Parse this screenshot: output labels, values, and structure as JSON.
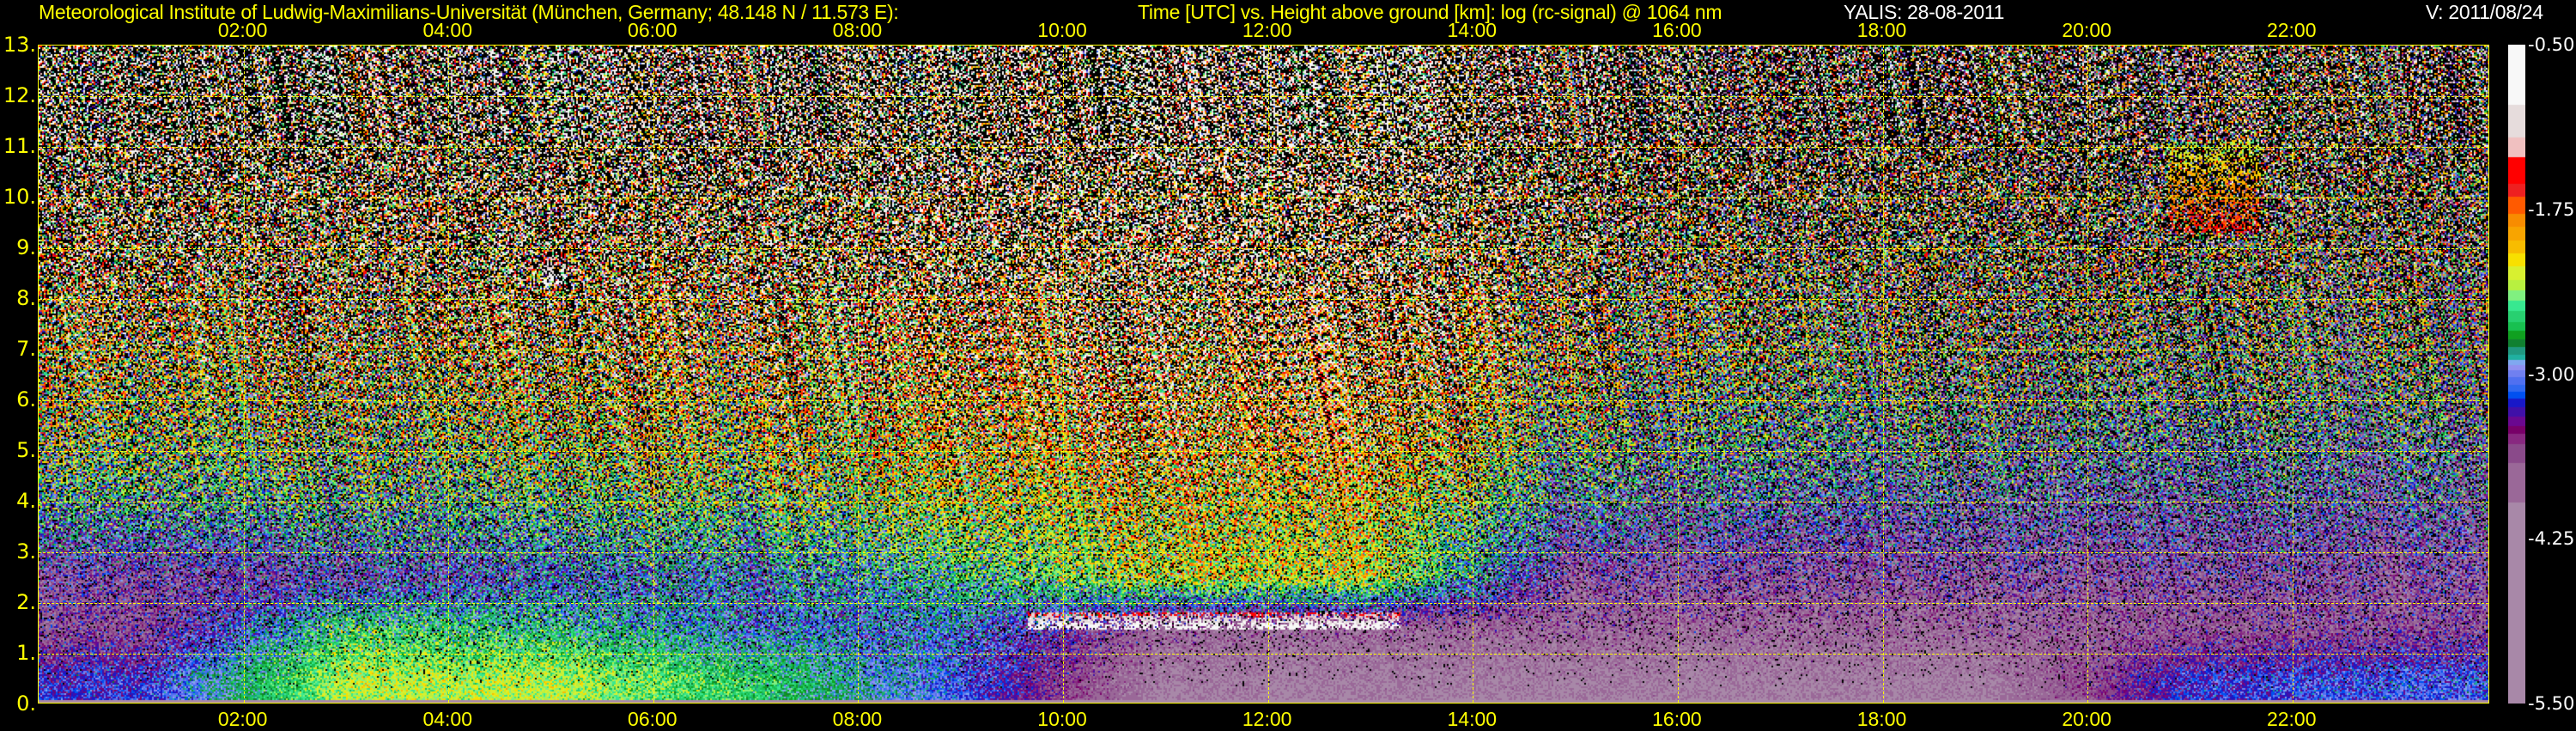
{
  "header": {
    "institute": "Meteorological Institute of Ludwig-Maximilians-Universität (München, Germany; 48.148 N / 11.573 E):",
    "plot_title": "Time [UTC] vs. Height above ground [km]: log (rc-signal) @ 1064 nm",
    "instrument_date": "YALIS: 28-08-2011",
    "version": "V: 2011/08/24"
  },
  "chart_data": {
    "type": "heatmap",
    "title": "Time [UTC] vs. Height above ground [km]: log (rc-signal) @ 1064 nm",
    "xlabel": "Time [UTC]",
    "ylabel": "Height above ground [km]",
    "xlim_hours": [
      0,
      23.93
    ],
    "ylim_km": [
      0,
      13
    ],
    "grid": true,
    "x_ticks": [
      {
        "h": 2,
        "label": "02:00"
      },
      {
        "h": 4,
        "label": "04:00"
      },
      {
        "h": 6,
        "label": "06:00"
      },
      {
        "h": 8,
        "label": "08:00"
      },
      {
        "h": 10,
        "label": "10:00"
      },
      {
        "h": 12,
        "label": "12:00"
      },
      {
        "h": 14,
        "label": "14:00"
      },
      {
        "h": 16,
        "label": "16:00"
      },
      {
        "h": 18,
        "label": "18:00"
      },
      {
        "h": 20,
        "label": "20:00"
      },
      {
        "h": 22,
        "label": "22:00"
      }
    ],
    "y_ticks": [
      {
        "km": 0,
        "label": "0."
      },
      {
        "km": 1,
        "label": "1."
      },
      {
        "km": 2,
        "label": "2."
      },
      {
        "km": 3,
        "label": "3."
      },
      {
        "km": 4,
        "label": "4."
      },
      {
        "km": 5,
        "label": "5."
      },
      {
        "km": 6,
        "label": "6."
      },
      {
        "km": 7,
        "label": "7."
      },
      {
        "km": 8,
        "label": "8."
      },
      {
        "km": 9,
        "label": "9."
      },
      {
        "km": 10,
        "label": "10."
      },
      {
        "km": 11,
        "label": "11."
      },
      {
        "km": 12,
        "label": "12."
      },
      {
        "km": 13,
        "label": "13."
      }
    ],
    "colorbar": {
      "range": [
        -5.5,
        -0.5
      ],
      "ticks": [
        {
          "v": -0.5,
          "label": "-0.50"
        },
        {
          "v": -1.75,
          "label": "-1.75"
        },
        {
          "v": -3.0,
          "label": "-3.00"
        },
        {
          "v": -4.25,
          "label": "-4.25"
        },
        {
          "v": -5.5,
          "label": "-5.50"
        }
      ],
      "levels": [
        [
          -0.95,
          "#f8f8f8"
        ],
        [
          -1.2,
          "#e6dcdc"
        ],
        [
          -1.35,
          "#f0c0c0"
        ],
        [
          -1.55,
          "#ff0000"
        ],
        [
          -1.65,
          "#ee2020"
        ],
        [
          -1.78,
          "#ff5a00"
        ],
        [
          -1.88,
          "#f88c00"
        ],
        [
          -1.98,
          "#f8a400"
        ],
        [
          -2.08,
          "#f8bc00"
        ],
        [
          -2.18,
          "#f8e000"
        ],
        [
          -2.28,
          "#d8f030"
        ],
        [
          -2.36,
          "#b8f040"
        ],
        [
          -2.44,
          "#80f080"
        ],
        [
          -2.52,
          "#38e890"
        ],
        [
          -2.6,
          "#28d070"
        ],
        [
          -2.67,
          "#18c050"
        ],
        [
          -2.73,
          "#10a020"
        ],
        [
          -2.79,
          "#108030"
        ],
        [
          -2.85,
          "#209880"
        ],
        [
          -2.89,
          "#20b0a0"
        ],
        [
          -2.93,
          "#80a8f0"
        ],
        [
          -2.97,
          "#9090f0"
        ],
        [
          -3.02,
          "#7080f0"
        ],
        [
          -3.08,
          "#5070f0"
        ],
        [
          -3.13,
          "#3068f0"
        ],
        [
          -3.18,
          "#0050f0"
        ],
        [
          -3.25,
          "#1818c8"
        ],
        [
          -3.32,
          "#4010a8"
        ],
        [
          -3.39,
          "#6a0890"
        ],
        [
          -3.45,
          "#780068"
        ],
        [
          -3.53,
          "#882880"
        ],
        [
          -3.67,
          "#8a4a8a"
        ],
        [
          -3.97,
          "#9a6898"
        ],
        [
          -5.5,
          "#a888a8"
        ]
      ]
    },
    "grid_times_h": [
      1,
      3,
      5,
      7,
      9,
      11,
      13,
      15,
      17,
      19,
      21,
      23
    ],
    "grid_heights_km": [
      12.5,
      11.5,
      10.5,
      9.5,
      8.5,
      7.5,
      6.5,
      5.5,
      4.5,
      3.5,
      2.5,
      1.5,
      0.5
    ],
    "log_signal": [
      [
        -1.6,
        -1.6,
        -1.5,
        -1.5,
        -1.3,
        -1.2,
        -1.2,
        -1.8,
        -2.1,
        -2.2,
        -2.3,
        -2.3
      ],
      [
        -1.6,
        -1.6,
        -1.5,
        -1.5,
        -1.3,
        -1.2,
        -1.2,
        -1.8,
        -2.1,
        -2.2,
        -2.3,
        -2.3
      ],
      [
        -1.7,
        -1.7,
        -1.6,
        -1.6,
        -1.4,
        -1.3,
        -1.3,
        -1.9,
        -2.2,
        -2.3,
        -2.4,
        -2.4
      ],
      [
        -1.8,
        -1.8,
        -1.7,
        -1.7,
        -1.5,
        -1.4,
        -1.4,
        -2.0,
        -2.3,
        -2.4,
        -2.5,
        -2.5
      ],
      [
        -1.9,
        -1.9,
        -1.8,
        -1.8,
        -1.6,
        -1.5,
        -1.5,
        -2.1,
        -2.4,
        -2.5,
        -2.6,
        -2.6
      ],
      [
        -2.0,
        -2.0,
        -1.9,
        -1.9,
        -1.7,
        -1.6,
        -1.6,
        -2.2,
        -2.5,
        -2.6,
        -2.7,
        -2.7
      ],
      [
        -2.2,
        -2.2,
        -2.1,
        -2.0,
        -1.8,
        -1.7,
        -1.7,
        -2.4,
        -2.6,
        -2.7,
        -2.8,
        -2.8
      ],
      [
        -2.4,
        -2.4,
        -2.3,
        -2.2,
        -2.0,
        -1.8,
        -1.8,
        -2.6,
        -2.8,
        -2.9,
        -3.0,
        -3.0
      ],
      [
        -2.6,
        -2.6,
        -2.5,
        -2.4,
        -2.2,
        -2.0,
        -2.0,
        -2.9,
        -3.0,
        -3.1,
        -3.2,
        -3.2
      ],
      [
        -3.0,
        -2.9,
        -2.8,
        -2.7,
        -2.4,
        -2.2,
        -2.2,
        -3.2,
        -3.3,
        -3.4,
        -3.4,
        -3.4
      ],
      [
        -3.5,
        -3.3,
        -3.1,
        -3.0,
        -2.7,
        -2.2,
        -2.2,
        -3.6,
        -3.6,
        -3.6,
        -3.6,
        -3.6
      ],
      [
        -3.6,
        -2.6,
        -2.7,
        -3.0,
        -3.0,
        -3.8,
        -3.8,
        -3.8,
        -3.8,
        -3.8,
        -3.7,
        -3.6
      ],
      [
        -3.2,
        -2.3,
        -2.3,
        -2.6,
        -3.1,
        -4.0,
        -4.0,
        -4.0,
        -4.0,
        -4.0,
        -3.2,
        -3.1
      ]
    ],
    "cloud_layers": [
      {
        "t_start_h": 9.65,
        "t_end_h": 13.3,
        "base_km": 1.45,
        "top_km": 1.8,
        "log_signal": -0.6
      },
      {
        "t_start_h": 4.9,
        "t_end_h": 5.15,
        "base_km": 8.3,
        "top_km": 8.9,
        "log_signal": -0.7
      },
      {
        "t_start_h": 20.8,
        "t_end_h": 21.7,
        "base_km": 9.3,
        "top_km": 11.1,
        "log_signal": -1.5
      }
    ]
  }
}
